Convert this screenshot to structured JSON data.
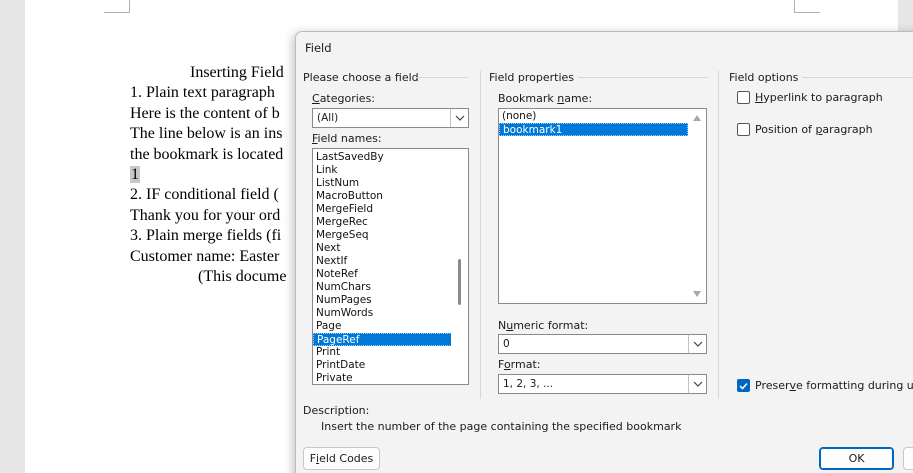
{
  "document": {
    "lines": [
      "Inserting Field",
      "1. Plain text paragraph",
      "Here is the content of b",
      "The line below is an ins",
      "the bookmark is located",
      "1",
      "2. IF conditional field (",
      "Thank you for your ord",
      "3. Plain merge fields (fi",
      "Customer name: Easter",
      "(This docume"
    ]
  },
  "dialog": {
    "title": "Field",
    "choose_group": "Please choose a field",
    "categories_label": "Categories:",
    "categories_value": "(All)",
    "field_names_label": "Field names:",
    "field_names": [
      "LastSavedBy",
      "Link",
      "ListNum",
      "MacroButton",
      "MergeField",
      "MergeRec",
      "MergeSeq",
      "Next",
      "NextIf",
      "NoteRef",
      "NumChars",
      "NumPages",
      "NumWords",
      "Page",
      "PageRef",
      "Print",
      "PrintDate",
      "Private"
    ],
    "field_names_selected": "PageRef",
    "properties_group": "Field properties",
    "bookmark_label": "Bookmark name:",
    "bookmarks": [
      "(none)",
      "bookmark1"
    ],
    "bookmark_selected": "bookmark1",
    "numeric_format_label": "Numeric format:",
    "numeric_format_value": "0",
    "format_label": "Format:",
    "format_value": "1, 2, 3, ...",
    "options_group": "Field options",
    "opt_hyperlink": "Hyperlink to paragraph",
    "opt_hyperlink_checked": false,
    "opt_position": "Position of paragraph",
    "opt_position_checked": false,
    "opt_preserve": "Preserve formatting during upd",
    "opt_preserve_checked": true,
    "description_label": "Description:",
    "description_text": "Insert the number of the page containing the specified bookmark",
    "field_codes_button": "Field Codes",
    "ok_button": "OK"
  },
  "colors": {
    "selection": "#0078d7",
    "checkbox_on": "#0067c0",
    "dialog_bg": "#f3f3f3"
  }
}
